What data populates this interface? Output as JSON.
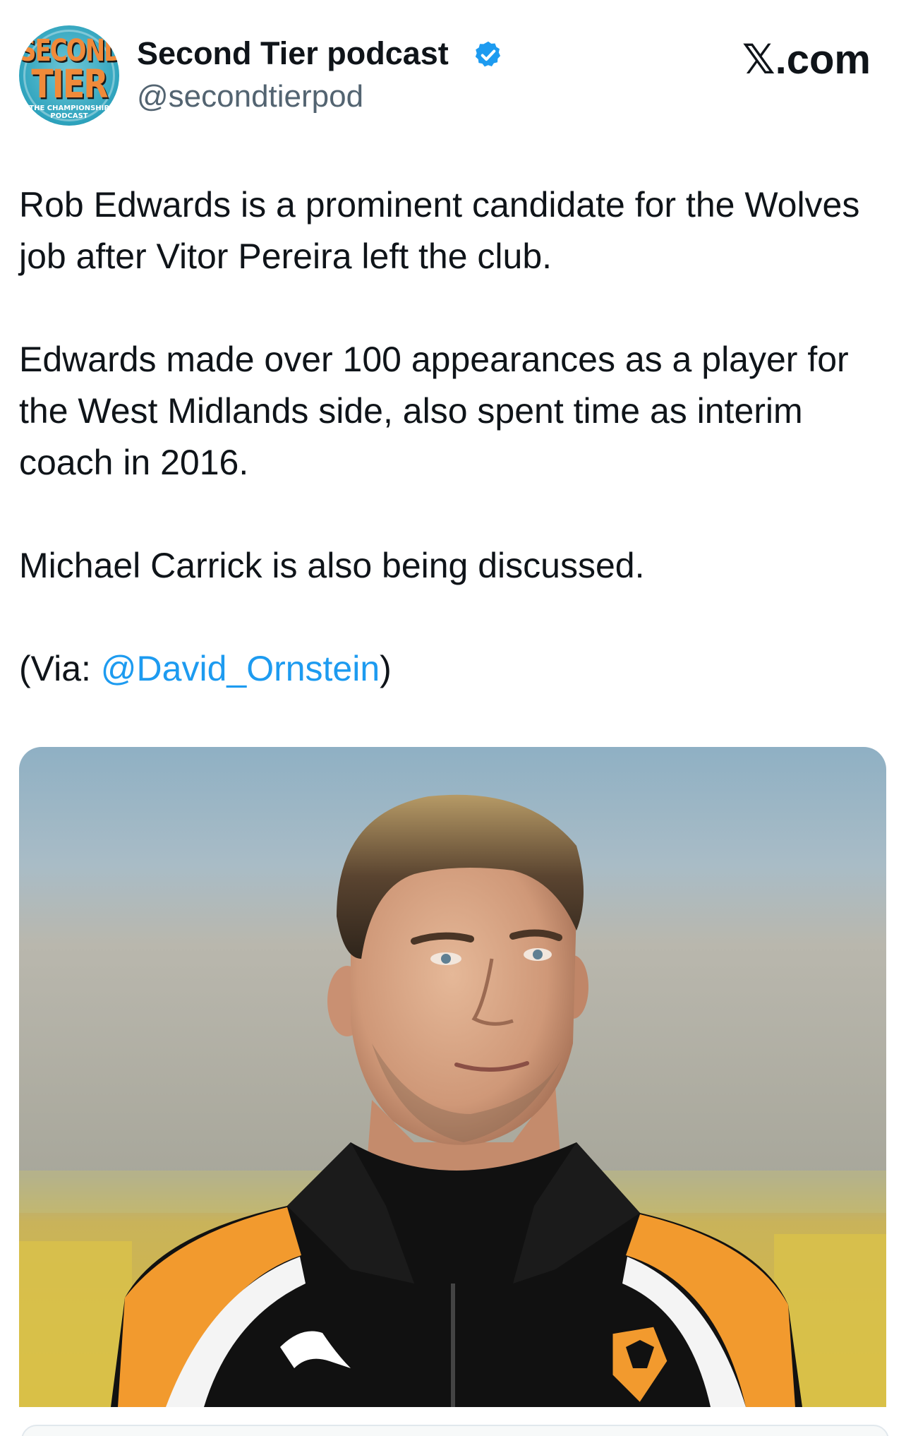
{
  "header": {
    "avatar_logo": {
      "line1": "SECOND",
      "line2": "TIER",
      "line3": "THE CHAMPIONSHIP PODCAST"
    },
    "author_name": "Second Tier podcast",
    "author_handle": "@secondtierpod",
    "verified_icon": "verified-badge-icon",
    "site_mark": "𝕏.com"
  },
  "tweet": {
    "paragraph1": "Rob Edwards is a prominent candidate for the Wolves job after Vitor Pereira left the club.",
    "paragraph2": "Edwards made over 100 appearances as a player for the West Midlands side, also spent time as interim coach in 2016.",
    "paragraph3": "Michael Carrick is also being discussed.",
    "via_prefix": "(Via: ",
    "via_mention": "@David_Ornstein",
    "via_suffix": ")"
  },
  "media": {
    "type": "photo",
    "subject": "man in black and orange Wolves training jacket"
  },
  "colors": {
    "link": "#1d9bf0",
    "verified": "#1d9bf0",
    "secondary_text": "#536471",
    "jacket_orange": "#f29a2e"
  }
}
